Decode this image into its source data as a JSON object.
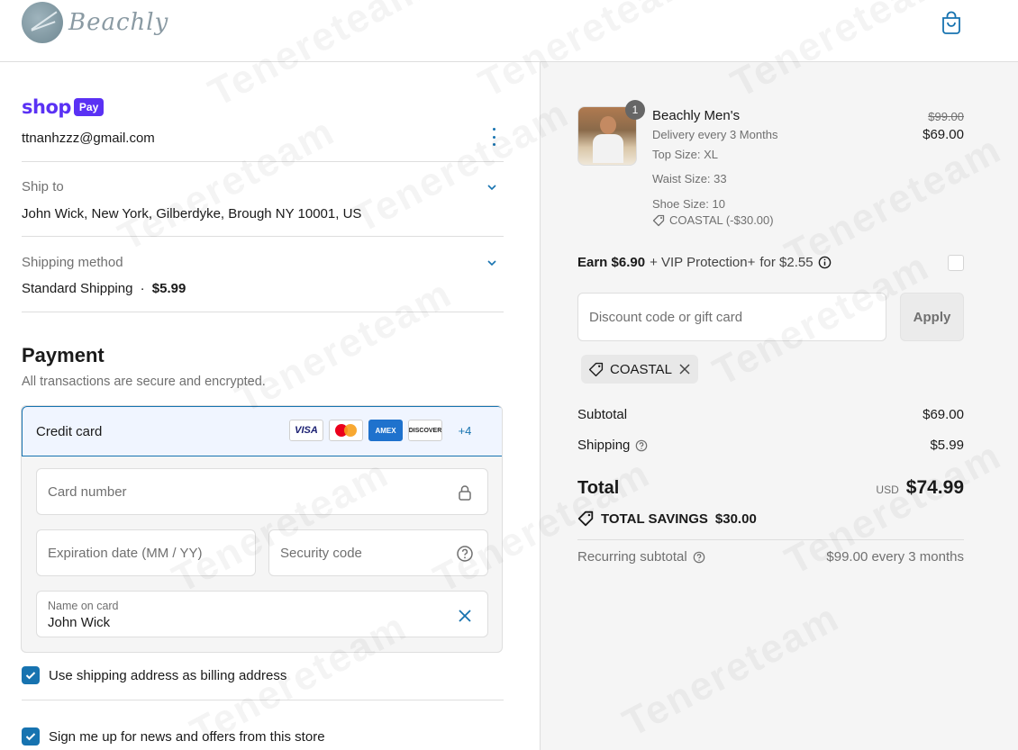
{
  "header": {
    "logo_text": "Beachly",
    "cart_icon": "shopping-bag-icon"
  },
  "shop_pay": {
    "brand": "shop",
    "badge": "Pay",
    "email": "ttnanhzzz@gmail.com"
  },
  "ship_to": {
    "label": "Ship to",
    "value": "John Wick, New York, Gilberdyke, Brough NY 10001, US"
  },
  "shipping_method": {
    "label": "Shipping method",
    "value": "Standard Shipping",
    "separator": "·",
    "price": "$5.99"
  },
  "payment": {
    "title": "Payment",
    "subtitle": "All transactions are secure and encrypted.",
    "method_label": "Credit card",
    "cards": [
      "VISA",
      "mastercard",
      "AMEX",
      "DISCOVER"
    ],
    "more_cards": "+4",
    "card_number_placeholder": "Card number",
    "expiration_placeholder": "Expiration date (MM / YY)",
    "security_placeholder": "Security code",
    "name_label": "Name on card",
    "name_value": "John Wick"
  },
  "checkboxes": {
    "billing_same": "Use shipping address as billing address",
    "newsletter": "Sign me up for news and offers from this store"
  },
  "order": {
    "quantity": "1",
    "product_name": "Beachly Men's",
    "delivery": "Delivery every 3 Months",
    "top_size": "Top Size: XL",
    "waist_size": "Waist Size: 33",
    "shoe_size": "Shoe Size: 10",
    "discount_line": "COASTAL (-$30.00)",
    "price_original": "$99.00",
    "price_current": "$69.00"
  },
  "vip": {
    "earn": "Earn $6.90",
    "plus": "+ VIP Protection+",
    "for_price": "for $2.55"
  },
  "discount": {
    "placeholder": "Discount code or gift card",
    "apply_label": "Apply",
    "applied_code": "COASTAL"
  },
  "summary": {
    "subtotal_label": "Subtotal",
    "subtotal_value": "$69.00",
    "shipping_label": "Shipping",
    "shipping_value": "$5.99",
    "total_label": "Total",
    "currency": "USD",
    "total_value": "$74.99",
    "savings_label": "TOTAL SAVINGS",
    "savings_value": "$30.00",
    "recurring_label": "Recurring subtotal",
    "recurring_value": "$99.00 every 3 months"
  },
  "watermark": "Tenereteam",
  "colors": {
    "accent": "#1773b0",
    "shop_purple": "#5a31f4",
    "sidebar_bg": "#f5f5f5"
  }
}
